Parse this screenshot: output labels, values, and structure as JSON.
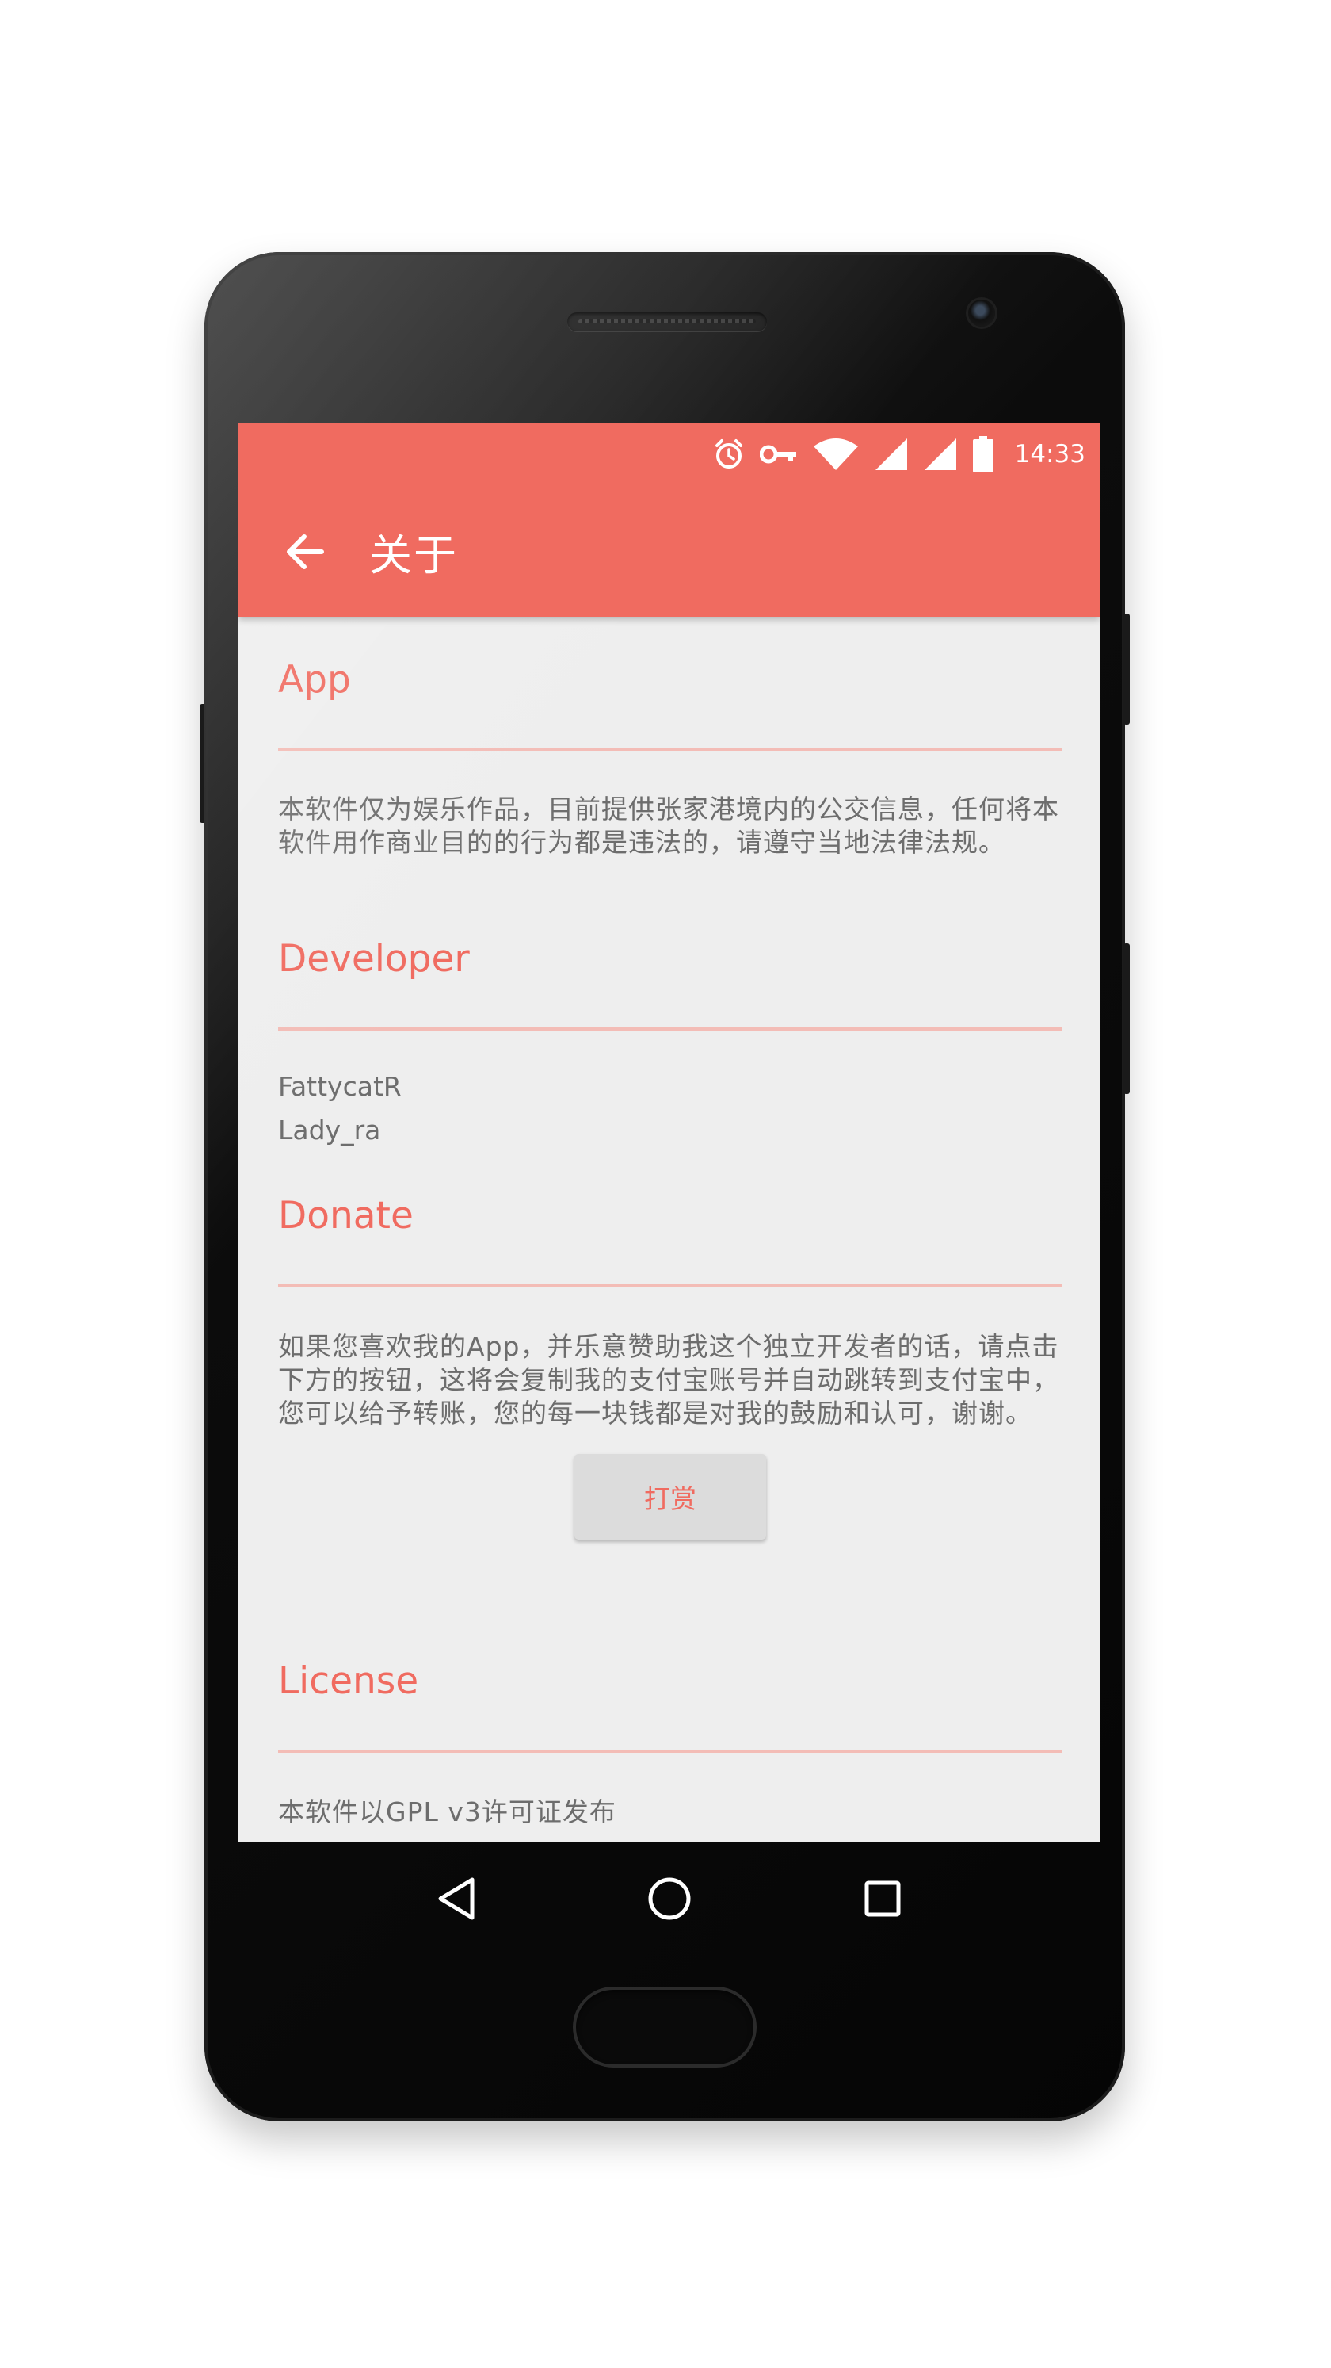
{
  "status_bar": {
    "time": "14:33",
    "icons": [
      "alarm-icon",
      "vpn-key-icon",
      "wifi-icon",
      "signal-icon",
      "signal-icon",
      "battery-icon"
    ]
  },
  "toolbar": {
    "back_icon": "arrow-back-icon",
    "title": "关于",
    "color": "#f06b60"
  },
  "sections": {
    "app": {
      "title": "App",
      "body": "本软件仅为娱乐作品，目前提供张家港境内的公交信息，任何将本软件用作商业目的的行为都是违法的，请遵守当地法律法规。"
    },
    "developer": {
      "title": "Developer",
      "names": [
        "FattycatR",
        "Lady_ra"
      ]
    },
    "donate": {
      "title": "Donate",
      "body": "如果您喜欢我的App，并乐意赞助我这个独立开发者的话，请点击下方的按钮，这将会复制我的支付宝账号并自动跳转到支付宝中，您可以给予转账，您的每一块钱都是对我的鼓励和认可，谢谢。",
      "button_label": "打赏"
    },
    "license": {
      "title": "License",
      "body": "本软件以GPL v3许可证发布"
    }
  },
  "nav_bar": {
    "buttons": [
      "back-triangle-icon",
      "home-circle-icon",
      "recents-square-icon"
    ]
  },
  "colors": {
    "accent": "#f06b60",
    "divider": "#f3bcb6",
    "content_bg": "#eeeeee",
    "body_text": "#6d6d6d"
  }
}
